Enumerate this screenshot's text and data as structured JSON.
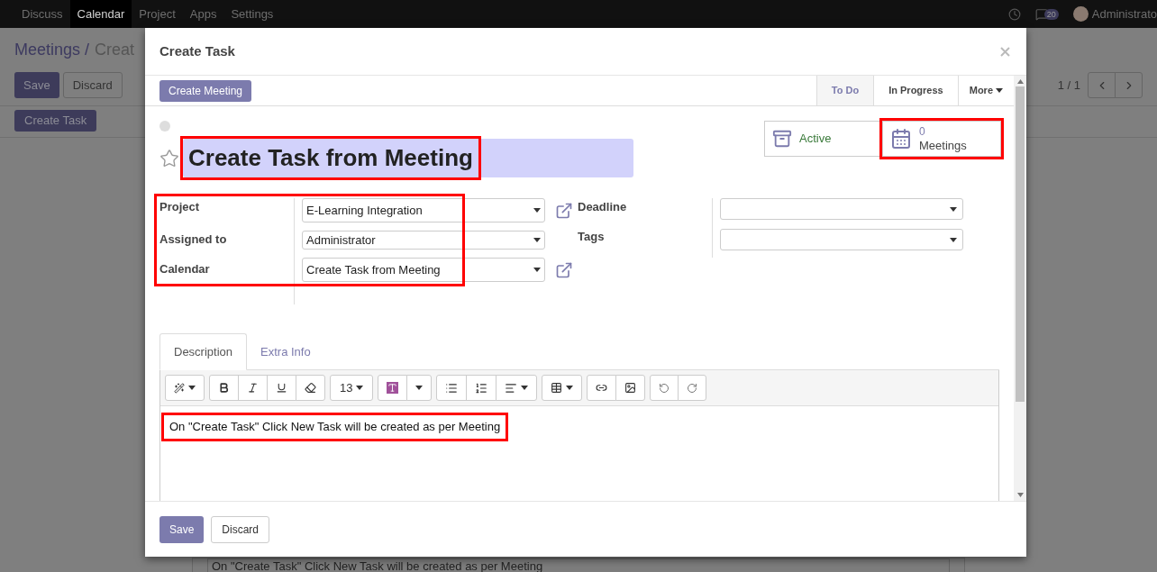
{
  "nav": {
    "items": [
      {
        "label": "Discuss",
        "selected": false
      },
      {
        "label": "Calendar",
        "selected": true
      },
      {
        "label": "Project",
        "selected": false
      },
      {
        "label": "Apps",
        "selected": false
      },
      {
        "label": "Settings",
        "selected": false
      }
    ],
    "message_count": "20",
    "user": "Administrato"
  },
  "page": {
    "breadcrumb": "Meetings /",
    "breadcrumb_current": "Creat",
    "save": "Save",
    "discard": "Discard",
    "pager": "1 / 1",
    "action_button": "Create Task",
    "note": "On \"Create Task\" Click New Task will be created as per Meeting"
  },
  "dialog": {
    "title": "Create Task",
    "header_button": "Create Meeting",
    "stages": [
      {
        "label": "To Do",
        "selected": true
      },
      {
        "label": "In Progress",
        "selected": false
      }
    ],
    "more": "More",
    "smart_buttons": [
      {
        "kind": "archive",
        "value": "Active",
        "highlighted": false
      },
      {
        "kind": "calendar",
        "count": "0",
        "value": "Meetings",
        "highlighted": true
      }
    ],
    "task_title": {
      "value": "Create Task from Meeting",
      "highlighted": true
    },
    "left_fields": {
      "highlighted": true,
      "fields": [
        {
          "label": "Project",
          "value": "E-Learning Integration",
          "link": true
        },
        {
          "label": "Assigned to",
          "value": "Administrator",
          "link": false
        },
        {
          "label": "Calendar",
          "value": "Create Task from Meeting",
          "link": true
        }
      ]
    },
    "right_fields": [
      {
        "label": "Deadline"
      },
      {
        "label": "Tags"
      }
    ],
    "tabs": [
      {
        "label": "Description",
        "selected": true
      },
      {
        "label": "Extra Info",
        "selected": false
      }
    ],
    "font_size": "13",
    "description": {
      "value": "On \"Create Task\" Click New Task will be created as per Meeting",
      "highlighted": true
    },
    "footer": {
      "save": "Save",
      "discard": "Discard"
    }
  }
}
